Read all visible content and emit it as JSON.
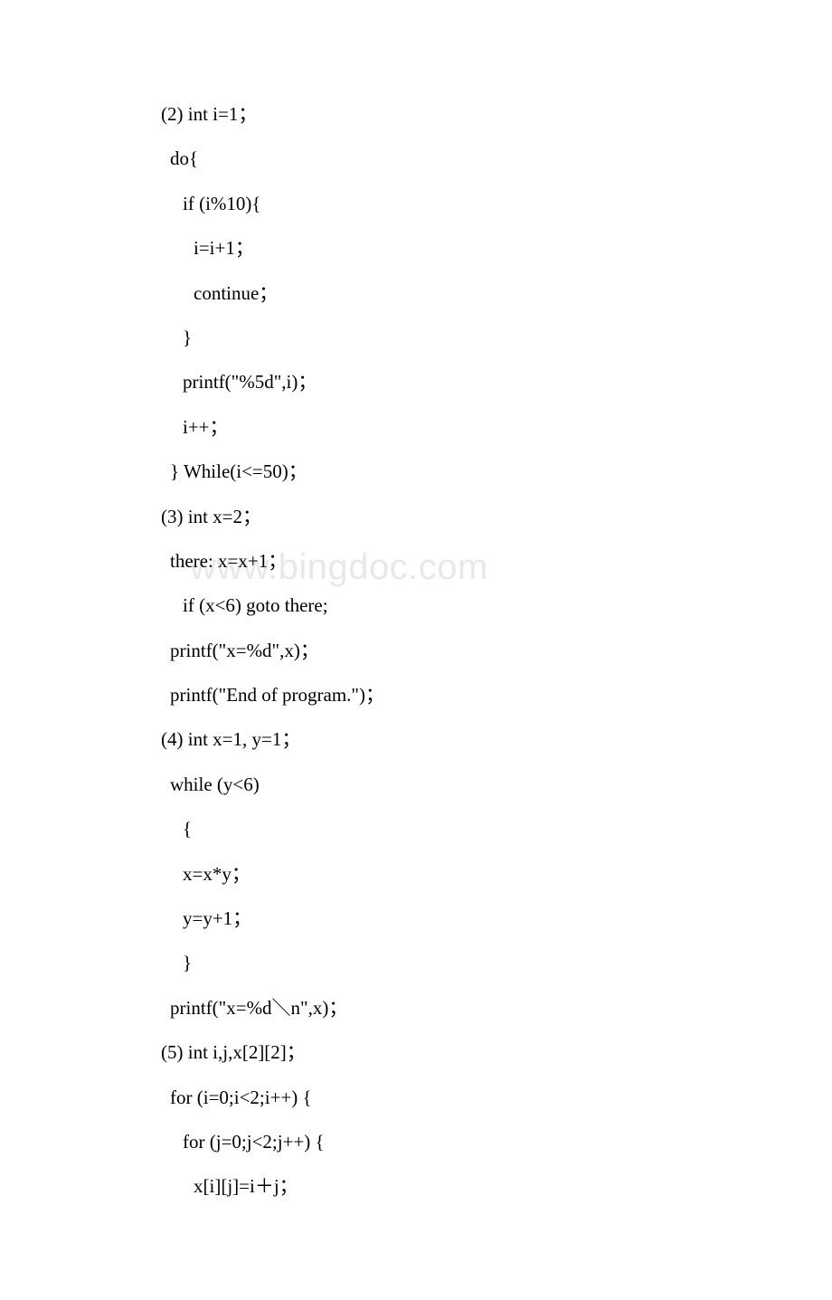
{
  "watermark": "www.bingdoc.com",
  "lines": {
    "l1": "(2)  int i=1；",
    "l2": " do{",
    "l3": "  if (i%10){",
    "l4": "   i=i+1；",
    "l5": "   continue；",
    "l6": "  }",
    "l7": "  printf(\"%5d\",i)；",
    "l8": "  i++；",
    "l9": " } While(i<=50)；",
    "l10": "(3)  int x=2；",
    "l11": " there: x=x+1；",
    "l12": "  if (x<6) goto there;",
    "l13": " printf(\"x=%d\",x)；",
    "l14": " printf(\"End of program.\")；",
    "l15": "(4)  int x=1, y=1；",
    "l16": " while (y<6)",
    "l17": "  {",
    "l18": "  x=x*y；",
    "l19": "  y=y+1；",
    "l20": "  }",
    "l21": " printf(\"x=%d＼n\",x)；",
    "l22": "(5)  int i,j,x[2][2]；",
    "l23": " for (i=0;i<2;i++) {",
    "l24": "  for (j=0;j<2;j++) {",
    "l25": "   x[i][j]=i＋j；"
  }
}
